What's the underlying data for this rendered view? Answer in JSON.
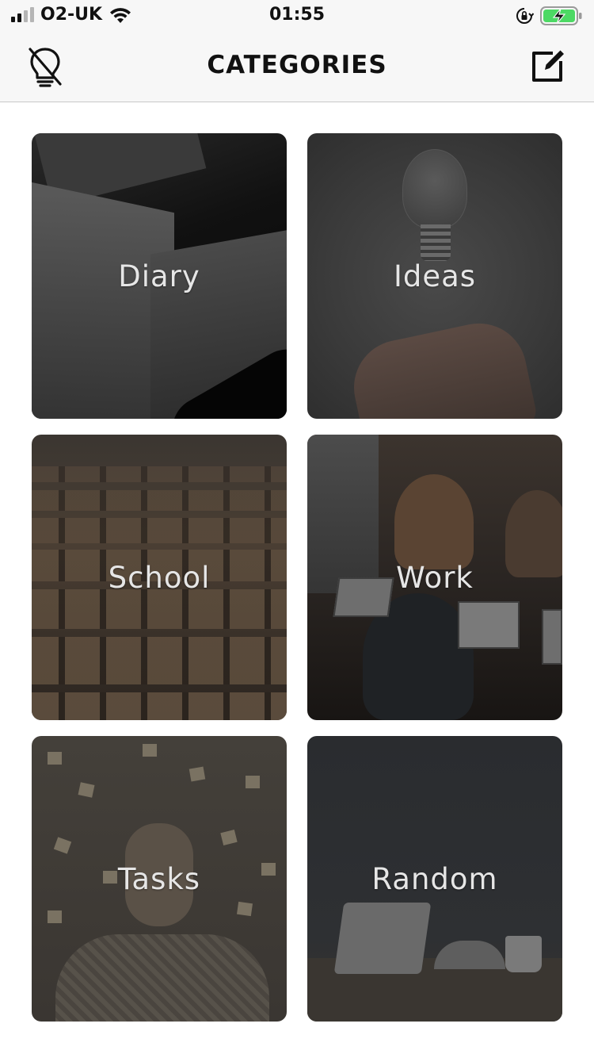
{
  "status_bar": {
    "carrier": "O2-UK",
    "time": "01:55",
    "signal_bars_on": 2,
    "signal_bars_total": 4,
    "battery_charging": true,
    "icons": [
      "signal-icon",
      "wifi-icon",
      "orientation-lock-icon",
      "battery-charging-icon"
    ]
  },
  "nav": {
    "title": "CATEGORIES",
    "left_icon": "lightbulb-off-icon",
    "right_icon": "compose-icon"
  },
  "categories": [
    {
      "label": "Diary"
    },
    {
      "label": "Ideas"
    },
    {
      "label": "School"
    },
    {
      "label": "Work"
    },
    {
      "label": "Tasks"
    },
    {
      "label": "Random"
    }
  ],
  "colors": {
    "bar_background": "#f7f7f7",
    "title": "#111111",
    "tile_label": "#e6e6e6",
    "battery_fill": "#4cd964"
  }
}
